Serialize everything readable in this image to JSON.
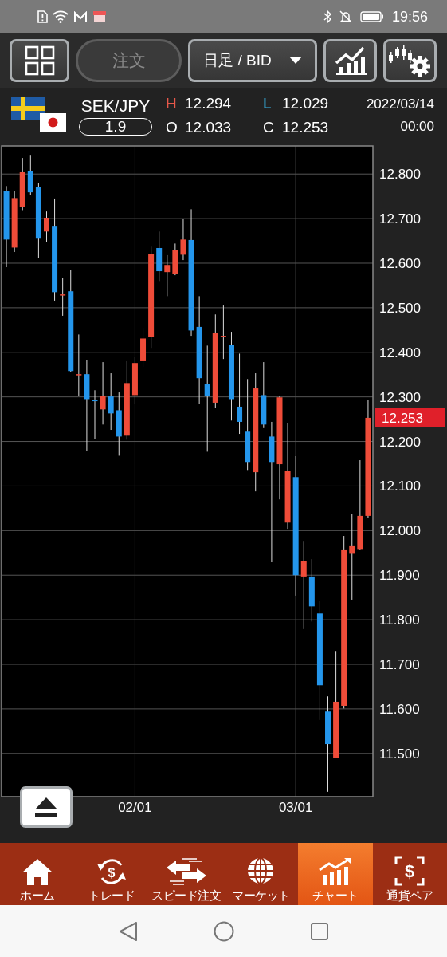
{
  "status_bar": {
    "time": "19:56"
  },
  "toolbar": {
    "order_button": {
      "label": "注文",
      "disabled": true
    },
    "timeframe_dropdown": {
      "label": "日足 / BID"
    }
  },
  "quote": {
    "pair": "SEK/JPY",
    "spread": "1.9",
    "date": "2022/03/14",
    "time": "00:00",
    "stats": [
      {
        "label": "H",
        "value": "12.294",
        "color": "#e8584a"
      },
      {
        "label": "L",
        "value": "12.029",
        "color": "#38b6e8"
      },
      {
        "label": "O",
        "value": "12.033",
        "color": "#ffffff"
      },
      {
        "label": "C",
        "value": "12.253",
        "color": "#ffffff"
      }
    ]
  },
  "chart": {
    "price_tag": "12.253",
    "chart_data": {
      "type": "candlestick",
      "grid": true,
      "ylim": [
        11.403,
        12.863
      ],
      "categories": [
        null,
        null,
        null,
        null,
        null,
        null,
        null,
        null,
        null,
        null,
        null,
        null,
        null,
        null,
        null,
        null,
        "02/01",
        null,
        null,
        null,
        null,
        null,
        null,
        null,
        null,
        null,
        null,
        null,
        null,
        null,
        null,
        null,
        null,
        null,
        null,
        null,
        "03/01",
        null,
        null,
        null,
        null,
        null,
        null,
        null,
        null,
        null
      ],
      "yticks": [
        {
          "value": 11.5,
          "label": "11.500"
        },
        {
          "value": 11.6,
          "label": "11.600"
        },
        {
          "value": 11.7,
          "label": "11.700"
        },
        {
          "value": 11.8,
          "label": "11.800"
        },
        {
          "value": 11.9,
          "label": "11.900"
        },
        {
          "value": 12.0,
          "label": "12.000"
        },
        {
          "value": 12.1,
          "label": "12.100"
        },
        {
          "value": 12.2,
          "label": "12.200"
        },
        {
          "value": 12.3,
          "label": "12.300"
        },
        {
          "value": 12.4,
          "label": "12.400"
        },
        {
          "value": 12.5,
          "label": "12.500"
        },
        {
          "value": 12.6,
          "label": "12.600"
        },
        {
          "value": 12.7,
          "label": "12.700"
        },
        {
          "value": 12.8,
          "label": "12.800"
        }
      ],
      "ohlc": [
        [
          12.761,
          12.773,
          12.591,
          12.653
        ],
        [
          12.635,
          12.761,
          12.625,
          12.746
        ],
        [
          12.727,
          12.836,
          12.719,
          12.804
        ],
        [
          12.807,
          12.843,
          12.753,
          12.759
        ],
        [
          12.77,
          12.78,
          12.612,
          12.655
        ],
        [
          12.671,
          12.716,
          12.648,
          12.702
        ],
        [
          12.682,
          12.745,
          12.516,
          12.535
        ],
        [
          12.529,
          12.566,
          12.482,
          12.53
        ],
        [
          12.537,
          12.584,
          12.356,
          12.358
        ],
        [
          12.35,
          12.44,
          12.303,
          12.351
        ],
        [
          12.351,
          12.383,
          12.179,
          12.295
        ],
        [
          12.293,
          12.315,
          12.206,
          12.292
        ],
        [
          12.272,
          12.378,
          12.238,
          12.303
        ],
        [
          12.301,
          12.353,
          12.226,
          12.263
        ],
        [
          12.27,
          12.31,
          12.168,
          12.211
        ],
        [
          12.213,
          12.38,
          12.204,
          12.331
        ],
        [
          12.304,
          12.389,
          12.283,
          12.376
        ],
        [
          12.38,
          12.455,
          12.367,
          12.431
        ],
        [
          12.435,
          12.637,
          12.41,
          12.621
        ],
        [
          12.634,
          12.671,
          12.56,
          12.582
        ],
        [
          12.58,
          12.618,
          12.526,
          12.596
        ],
        [
          12.576,
          12.644,
          12.573,
          12.63
        ],
        [
          12.619,
          12.7,
          12.607,
          12.653
        ],
        [
          12.652,
          12.721,
          12.437,
          12.449
        ],
        [
          12.457,
          12.526,
          12.285,
          12.342
        ],
        [
          12.328,
          12.415,
          12.177,
          12.303
        ],
        [
          12.287,
          12.485,
          12.276,
          12.444
        ],
        [
          12.436,
          12.505,
          12.385,
          12.437
        ],
        [
          12.417,
          12.446,
          12.247,
          12.295
        ],
        [
          12.278,
          12.397,
          12.217,
          12.244
        ],
        [
          12.222,
          12.34,
          12.136,
          12.154
        ],
        [
          12.131,
          12.353,
          12.088,
          12.319
        ],
        [
          12.304,
          12.378,
          12.23,
          12.238
        ],
        [
          12.211,
          12.244,
          11.929,
          12.154
        ],
        [
          12.149,
          12.303,
          12.07,
          12.299
        ],
        [
          12.018,
          12.242,
          12.004,
          12.134
        ],
        [
          12.12,
          12.167,
          11.854,
          11.9
        ],
        [
          11.897,
          11.977,
          11.779,
          11.932
        ],
        [
          11.897,
          11.936,
          11.796,
          11.83
        ],
        [
          11.814,
          11.843,
          11.575,
          11.653
        ],
        [
          11.594,
          11.628,
          11.414,
          11.521
        ],
        [
          11.489,
          11.73,
          11.489,
          11.616
        ],
        [
          11.607,
          11.988,
          11.601,
          11.956
        ],
        [
          11.948,
          12.038,
          11.845,
          11.965
        ],
        [
          11.957,
          12.158,
          11.956,
          12.033
        ],
        [
          12.033,
          12.294,
          12.029,
          12.253
        ]
      ]
    }
  },
  "bottom_nav": [
    {
      "label": "ホーム",
      "selected": false
    },
    {
      "label": "トレード",
      "icon_text": "$",
      "selected": false
    },
    {
      "label": "スピード注文",
      "selected": false
    },
    {
      "label": "マーケット",
      "selected": false
    },
    {
      "label": "チャート",
      "selected": true
    },
    {
      "label": "通貨ペア",
      "icon_text": "$",
      "selected": false
    }
  ]
}
